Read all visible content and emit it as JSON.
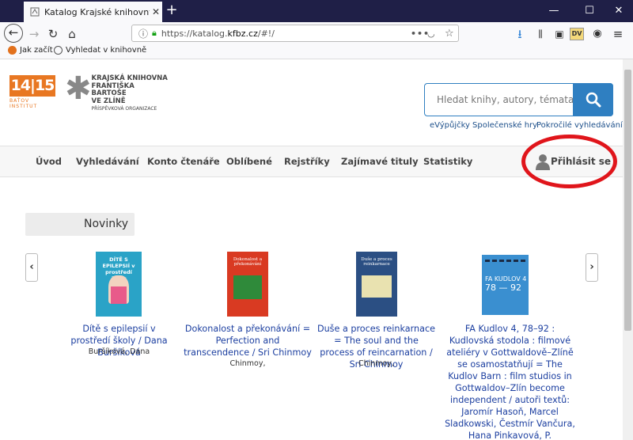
{
  "browser": {
    "tab_title": "Katalog Krajské knihovny Františka Bartoše",
    "url_prefix": "https://katalog.",
    "url_domain": "kfbz.cz",
    "url_suffix": "/#!/",
    "bookmarks": [
      "Jak začít",
      "Vyhledat v knihovně"
    ]
  },
  "header": {
    "logo_1415": "14|15",
    "logo_1415_sub": "BAŤOV INSTITUT",
    "logo_kfb_lines": [
      "KRAJSKÁ KNIHOVNA",
      "FRANTIŠKA BARTOŠE",
      "VE ZLÍNĚ"
    ],
    "logo_kfb_small": "PŘÍSPĚVKOVÁ ORGANIZACE",
    "search_placeholder": "Hledat knihy, autory, témata...",
    "links": [
      "eVýpůjčky",
      "Společenské hry",
      "Pokročilé vyhledávání"
    ]
  },
  "menu": {
    "items": [
      "Úvod",
      "Vyhledávání",
      "Konto čtenáře",
      "Oblíbené",
      "Rejstříky",
      "Zajímavé tituly",
      "Statistiky"
    ],
    "login": "Přihlásit se"
  },
  "section_title": "Novinky",
  "books": [
    {
      "title": "Dítě s epilepsií v prostředí školy / Dana Buršíková",
      "author": "Buršíková, Dana",
      "cover_text": "DÍTĚ S EPILEPSIÍ v prostředí školy",
      "cover_color": "#2aa3c7"
    },
    {
      "title": "Dokonalost a překonávání = Perfection and transcendence / Sri Chinmoy",
      "author": "Chinmoy,",
      "cover_text": "Dokonalost a překonávání",
      "cover_color": "#d93a22"
    },
    {
      "title": "Duše a proces reinkarnace = The soul and the process of reincarnation / Sri Chinmoy",
      "author": "Chinmoy,",
      "cover_text": "Duše a proces reinkarnace",
      "cover_color": "#2b4f83"
    },
    {
      "title": "FA Kudlov 4, 78–92 : Kudlovská stodola : filmové ateliéry v Gottwaldově–Zlíně se osamostatňují = The Kudlov Barn : film studios in Gottwaldov–Zlín become independent / autoři textů: Jaromír Hasoň, Marcel Sladkowski, Čestmír Vančura, Hana Pinkavová, P.",
      "author": "",
      "cover_text": "FA KUDLOV 4",
      "cover_text2": "78 — 92",
      "cover_color": "#3a8fd0"
    }
  ]
}
